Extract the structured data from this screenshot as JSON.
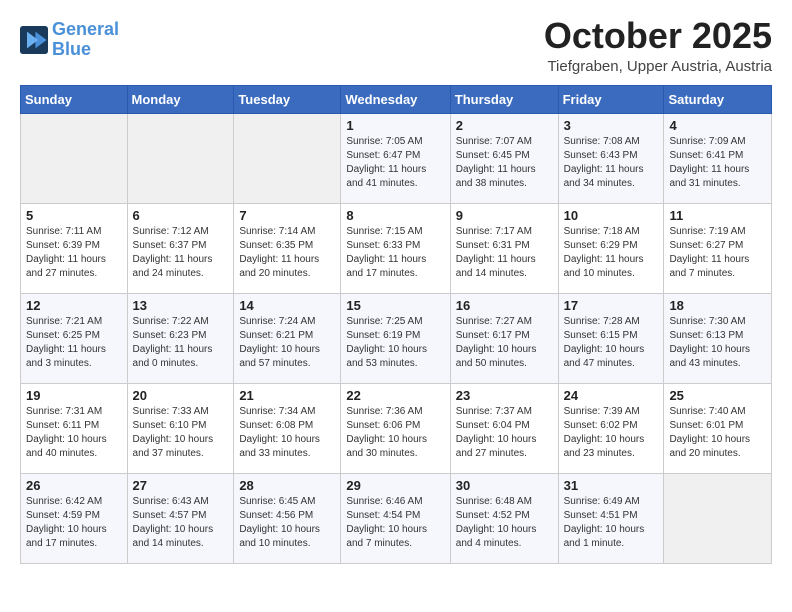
{
  "logo": {
    "line1": "General",
    "line2": "Blue"
  },
  "title": "October 2025",
  "subtitle": "Tiefgraben, Upper Austria, Austria",
  "weekdays": [
    "Sunday",
    "Monday",
    "Tuesday",
    "Wednesday",
    "Thursday",
    "Friday",
    "Saturday"
  ],
  "weeks": [
    [
      {
        "day": "",
        "info": ""
      },
      {
        "day": "",
        "info": ""
      },
      {
        "day": "",
        "info": ""
      },
      {
        "day": "1",
        "info": "Sunrise: 7:05 AM\nSunset: 6:47 PM\nDaylight: 11 hours\nand 41 minutes."
      },
      {
        "day": "2",
        "info": "Sunrise: 7:07 AM\nSunset: 6:45 PM\nDaylight: 11 hours\nand 38 minutes."
      },
      {
        "day": "3",
        "info": "Sunrise: 7:08 AM\nSunset: 6:43 PM\nDaylight: 11 hours\nand 34 minutes."
      },
      {
        "day": "4",
        "info": "Sunrise: 7:09 AM\nSunset: 6:41 PM\nDaylight: 11 hours\nand 31 minutes."
      }
    ],
    [
      {
        "day": "5",
        "info": "Sunrise: 7:11 AM\nSunset: 6:39 PM\nDaylight: 11 hours\nand 27 minutes."
      },
      {
        "day": "6",
        "info": "Sunrise: 7:12 AM\nSunset: 6:37 PM\nDaylight: 11 hours\nand 24 minutes."
      },
      {
        "day": "7",
        "info": "Sunrise: 7:14 AM\nSunset: 6:35 PM\nDaylight: 11 hours\nand 20 minutes."
      },
      {
        "day": "8",
        "info": "Sunrise: 7:15 AM\nSunset: 6:33 PM\nDaylight: 11 hours\nand 17 minutes."
      },
      {
        "day": "9",
        "info": "Sunrise: 7:17 AM\nSunset: 6:31 PM\nDaylight: 11 hours\nand 14 minutes."
      },
      {
        "day": "10",
        "info": "Sunrise: 7:18 AM\nSunset: 6:29 PM\nDaylight: 11 hours\nand 10 minutes."
      },
      {
        "day": "11",
        "info": "Sunrise: 7:19 AM\nSunset: 6:27 PM\nDaylight: 11 hours\nand 7 minutes."
      }
    ],
    [
      {
        "day": "12",
        "info": "Sunrise: 7:21 AM\nSunset: 6:25 PM\nDaylight: 11 hours\nand 3 minutes."
      },
      {
        "day": "13",
        "info": "Sunrise: 7:22 AM\nSunset: 6:23 PM\nDaylight: 11 hours\nand 0 minutes."
      },
      {
        "day": "14",
        "info": "Sunrise: 7:24 AM\nSunset: 6:21 PM\nDaylight: 10 hours\nand 57 minutes."
      },
      {
        "day": "15",
        "info": "Sunrise: 7:25 AM\nSunset: 6:19 PM\nDaylight: 10 hours\nand 53 minutes."
      },
      {
        "day": "16",
        "info": "Sunrise: 7:27 AM\nSunset: 6:17 PM\nDaylight: 10 hours\nand 50 minutes."
      },
      {
        "day": "17",
        "info": "Sunrise: 7:28 AM\nSunset: 6:15 PM\nDaylight: 10 hours\nand 47 minutes."
      },
      {
        "day": "18",
        "info": "Sunrise: 7:30 AM\nSunset: 6:13 PM\nDaylight: 10 hours\nand 43 minutes."
      }
    ],
    [
      {
        "day": "19",
        "info": "Sunrise: 7:31 AM\nSunset: 6:11 PM\nDaylight: 10 hours\nand 40 minutes."
      },
      {
        "day": "20",
        "info": "Sunrise: 7:33 AM\nSunset: 6:10 PM\nDaylight: 10 hours\nand 37 minutes."
      },
      {
        "day": "21",
        "info": "Sunrise: 7:34 AM\nSunset: 6:08 PM\nDaylight: 10 hours\nand 33 minutes."
      },
      {
        "day": "22",
        "info": "Sunrise: 7:36 AM\nSunset: 6:06 PM\nDaylight: 10 hours\nand 30 minutes."
      },
      {
        "day": "23",
        "info": "Sunrise: 7:37 AM\nSunset: 6:04 PM\nDaylight: 10 hours\nand 27 minutes."
      },
      {
        "day": "24",
        "info": "Sunrise: 7:39 AM\nSunset: 6:02 PM\nDaylight: 10 hours\nand 23 minutes."
      },
      {
        "day": "25",
        "info": "Sunrise: 7:40 AM\nSunset: 6:01 PM\nDaylight: 10 hours\nand 20 minutes."
      }
    ],
    [
      {
        "day": "26",
        "info": "Sunrise: 6:42 AM\nSunset: 4:59 PM\nDaylight: 10 hours\nand 17 minutes."
      },
      {
        "day": "27",
        "info": "Sunrise: 6:43 AM\nSunset: 4:57 PM\nDaylight: 10 hours\nand 14 minutes."
      },
      {
        "day": "28",
        "info": "Sunrise: 6:45 AM\nSunset: 4:56 PM\nDaylight: 10 hours\nand 10 minutes."
      },
      {
        "day": "29",
        "info": "Sunrise: 6:46 AM\nSunset: 4:54 PM\nDaylight: 10 hours\nand 7 minutes."
      },
      {
        "day": "30",
        "info": "Sunrise: 6:48 AM\nSunset: 4:52 PM\nDaylight: 10 hours\nand 4 minutes."
      },
      {
        "day": "31",
        "info": "Sunrise: 6:49 AM\nSunset: 4:51 PM\nDaylight: 10 hours\nand 1 minute."
      },
      {
        "day": "",
        "info": ""
      }
    ]
  ]
}
